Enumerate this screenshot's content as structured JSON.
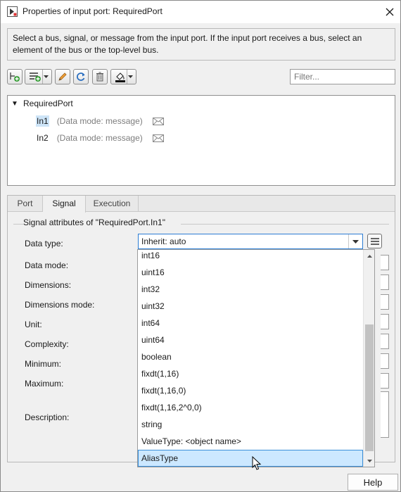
{
  "window": {
    "title": "Properties of input port: RequiredPort",
    "close_icon": "close-icon"
  },
  "description": "Select a bus, signal, or message from the input port. If the input port receives a bus, select an element of the bus or the top-level bus.",
  "toolbar": {
    "buttons": [
      "add-element-icon",
      "add-bus-icon",
      "edit-pencil-icon",
      "refresh-icon",
      "delete-icon",
      "fill-color-icon"
    ],
    "filter_placeholder": "Filter..."
  },
  "tree": {
    "root": "RequiredPort",
    "items": [
      {
        "name": "In1",
        "mode": "(Data mode: message)",
        "selected": true,
        "icon": "envelope-icon"
      },
      {
        "name": "In2",
        "mode": "(Data mode: message)",
        "selected": false,
        "icon": "envelope-icon"
      }
    ]
  },
  "tabs": [
    {
      "label": "Port",
      "active": false
    },
    {
      "label": "Signal",
      "active": true
    },
    {
      "label": "Execution",
      "active": false
    }
  ],
  "signal_group": {
    "title": "Signal attributes of \"RequiredPort.In1\"",
    "fields": {
      "data_type": "Data type:",
      "data_mode": "Data mode:",
      "dimensions": "Dimensions:",
      "dimensions_mode": "Dimensions mode:",
      "unit": "Unit:",
      "complexity": "Complexity:",
      "minimum": "Minimum:",
      "maximum": "Maximum:",
      "description": "Description:"
    },
    "data_type_value": "Inherit: auto"
  },
  "dropdown": {
    "options": [
      "int16",
      "uint16",
      "int32",
      "uint32",
      "int64",
      "uint64",
      "boolean",
      "fixdt(1,16)",
      "fixdt(1,16,0)",
      "fixdt(1,16,2^0,0)",
      "string",
      "ValueType: <object name>",
      "AliasType"
    ],
    "highlighted": "AliasType"
  },
  "footer": {
    "help_label": "Help"
  }
}
